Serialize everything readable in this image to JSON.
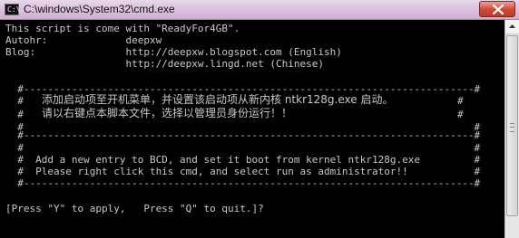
{
  "window": {
    "title": "C:\\windows\\System32\\cmd.exe",
    "icon_label": "C:\\"
  },
  "icons": {
    "app": "cmd-icon",
    "close": "close-icon",
    "scroll_up": "scroll-up-arrow-icon"
  },
  "console": {
    "header": [
      "This script is come with \"ReadyFor4GB\".",
      "Autohr:             deepxw",
      "Blog:               http://deepxw.blogspot.com (English)",
      "                    http://deepxw.lingd.net (Chinese)"
    ],
    "box": {
      "border_top": "  #---------------------------------------------------------------------------#",
      "blank": "  #                                                                           #",
      "cn_line1": "添加启动项至开机菜单，并设置该启动项从新内核 ntkr128g.exe 启动。",
      "cn_line2": "请以右键点本脚本文件，选择以管理员身份运行！！",
      "divider": "  #---------------------------------------------------------------------------#",
      "en_line1": "  #  Add a new entry to BCD, and set it boot from kernel ntkr128g.exe         #",
      "en_line2": "  #  Please right click this cmd, and select run as administrator!!           #",
      "border_bottom": "  #---------------------------------------------------------------------------#"
    },
    "prompt": "[Press \"Y\" to apply,   Press \"Q\" to quit.]?"
  },
  "colors": {
    "console_bg": "#000000",
    "console_fg": "#c8c8c8",
    "title_gradient_top": "#e9d7ea",
    "close_button": "#d34a3b"
  }
}
